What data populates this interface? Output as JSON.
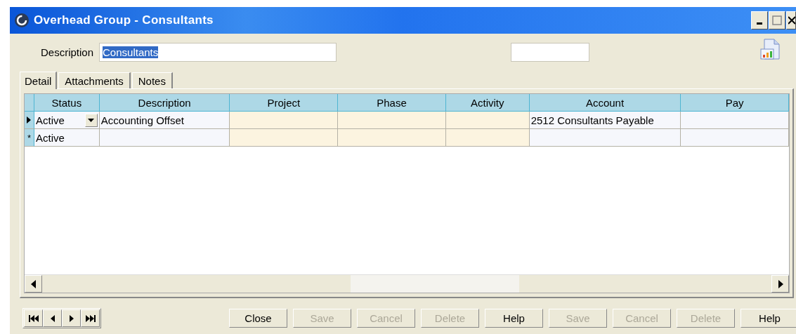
{
  "window": {
    "title": "Overhead Group - Consultants"
  },
  "form": {
    "description_label": "Description",
    "description_value": "Consultants",
    "description_selected": true
  },
  "tabs": [
    {
      "label": "Detail",
      "selected": true
    },
    {
      "label": "Attachments",
      "selected": false
    },
    {
      "label": "Notes",
      "selected": false
    }
  ],
  "table": {
    "columns": [
      {
        "label": "Status",
        "shaded": false
      },
      {
        "label": "Description",
        "shaded": false
      },
      {
        "label": "Project",
        "shaded": true
      },
      {
        "label": "Phase",
        "shaded": true
      },
      {
        "label": "Activity",
        "shaded": true
      },
      {
        "label": "Account",
        "shaded": false
      },
      {
        "label": "Pay",
        "shaded": false
      }
    ],
    "rows": [
      {
        "kind": "current",
        "cells": [
          "Active",
          "Accounting Offset",
          "",
          "",
          "",
          "2512 Consultants Payable",
          ""
        ]
      },
      {
        "kind": "new",
        "marker": "*",
        "cells": [
          "Active",
          "",
          "",
          "",
          "",
          "",
          ""
        ]
      }
    ]
  },
  "buttons": [
    {
      "label": "Close",
      "disabled": false
    },
    {
      "label": "Save",
      "disabled": true
    },
    {
      "label": "Cancel",
      "disabled": true
    },
    {
      "label": "Delete",
      "disabled": true
    },
    {
      "label": "Help",
      "disabled": false
    },
    {
      "label": "Save",
      "disabled": true
    },
    {
      "label": "Cancel",
      "disabled": true
    },
    {
      "label": "Delete",
      "disabled": true
    },
    {
      "label": "Help",
      "disabled": false
    }
  ]
}
